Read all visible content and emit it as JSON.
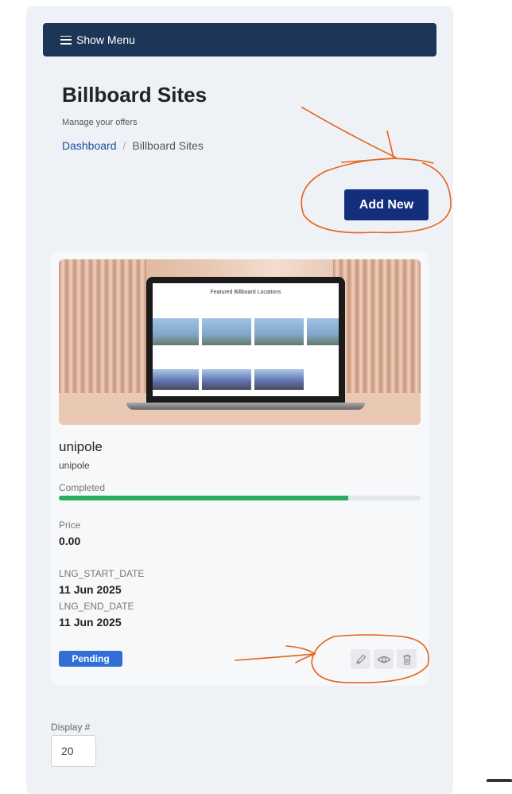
{
  "header": {
    "menu_label": "Show Menu"
  },
  "page": {
    "title": "Billboard Sites",
    "subtitle": "Manage your offers",
    "breadcrumb": [
      {
        "label": "Dashboard"
      },
      {
        "label": "Billboard Sites"
      }
    ],
    "add_button_label": "Add New"
  },
  "card": {
    "image_title": "Featured Billboard Locations",
    "title": "unipole",
    "subtitle": "unipole",
    "progress": {
      "label": "Completed",
      "percent": 80,
      "color": "#27ae60"
    },
    "price_label": "Price",
    "price_value": "0.00",
    "start_label": "LNG_START_DATE",
    "start_value": "11 Jun 2025",
    "end_label": "LNG_END_DATE",
    "end_value": "11 Jun 2025",
    "status": {
      "label": "Pending",
      "color": "#2f6fd6"
    },
    "actions": [
      {
        "icon": "pencil-icon"
      },
      {
        "icon": "eye-icon"
      },
      {
        "icon": "trash-icon"
      }
    ]
  },
  "display": {
    "label": "Display #",
    "value": "20"
  },
  "colors": {
    "nav": "#1d3557",
    "primary_button": "#132f7c",
    "annotation": "#e8601c"
  }
}
